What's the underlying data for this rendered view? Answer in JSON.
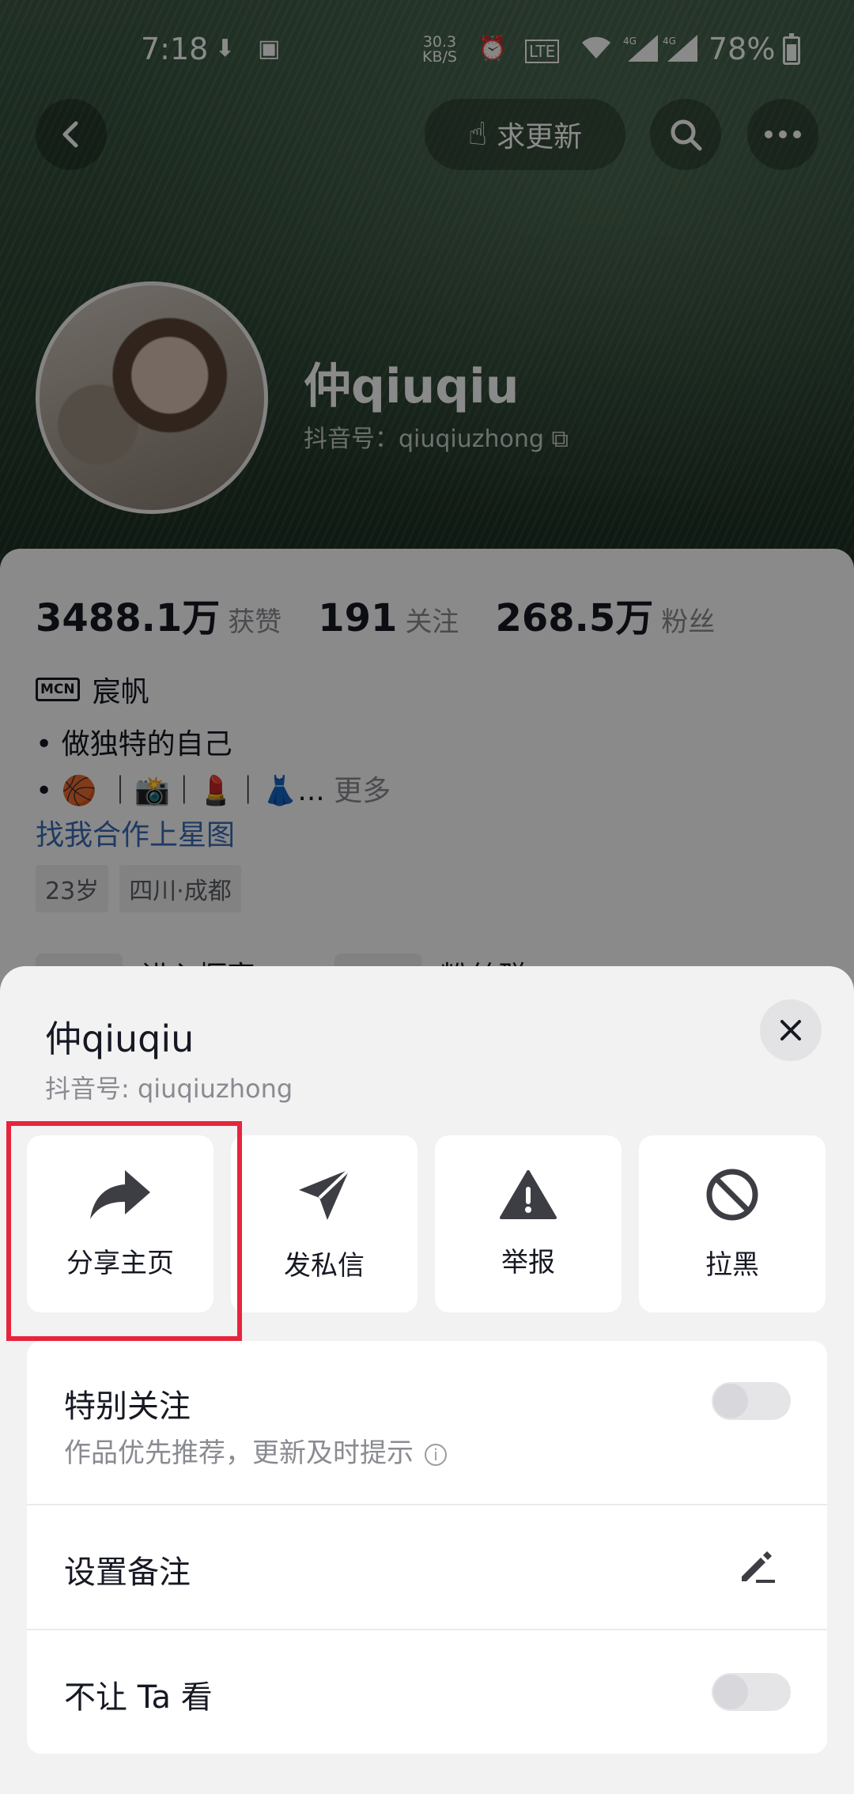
{
  "status_bar": {
    "time": "7:18",
    "network_speed_value": "30.3",
    "network_speed_unit": "KB/S",
    "battery": "78%",
    "icons": [
      "download-icon",
      "message-notification-icon",
      "alarm-icon",
      "volte-icon",
      "wifi-icon",
      "4g-signal-icon",
      "4g-signal-icon",
      "battery-icon"
    ]
  },
  "top_nav": {
    "back_icon": "chevron-left-icon",
    "request_update_label": "求更新",
    "search_icon": "search-icon",
    "more_icon": "more-dots-icon"
  },
  "profile": {
    "nickname": "仲qiuqiu",
    "douyin_id": "抖音号：qiuqiuzhong",
    "stats": [
      {
        "value": "3488.1万",
        "label": "获赞"
      },
      {
        "value": "191",
        "label": "关注"
      },
      {
        "value": "268.5万",
        "label": "粉丝"
      }
    ],
    "mcn_tag": "MCN",
    "mcn_name": "宸帆",
    "bio_line1": "• 做独特的自己",
    "bio_line2": "• 🏀 ｜📸｜💄｜👗...",
    "bio_more": "更多",
    "bio_link": "找我合作上星图",
    "tags": [
      "23岁",
      "四川·成都"
    ],
    "peek_items": [
      "进入橱窗",
      "粉丝群"
    ]
  },
  "sheet": {
    "title": "仲qiuqiu",
    "douyin_id": "抖音号: qiuqiuzhong",
    "actions": [
      {
        "label": "分享主页",
        "icon": "share-arrow-icon"
      },
      {
        "label": "发私信",
        "icon": "paper-plane-icon"
      },
      {
        "label": "举报",
        "icon": "warning-icon"
      },
      {
        "label": "拉黑",
        "icon": "block-icon"
      }
    ],
    "special_follow": {
      "title": "特别关注",
      "subtitle": "作品优先推荐，更新及时提示",
      "enabled": false
    },
    "set_remark": {
      "title": "设置备注",
      "icon": "pencil-icon"
    },
    "hide_from": {
      "title": "不让 Ta 看",
      "enabled": false
    }
  },
  "colors": {
    "highlight": "#e8243d",
    "link": "#3a6bb8",
    "sheet_bg": "#f2f2f3"
  }
}
